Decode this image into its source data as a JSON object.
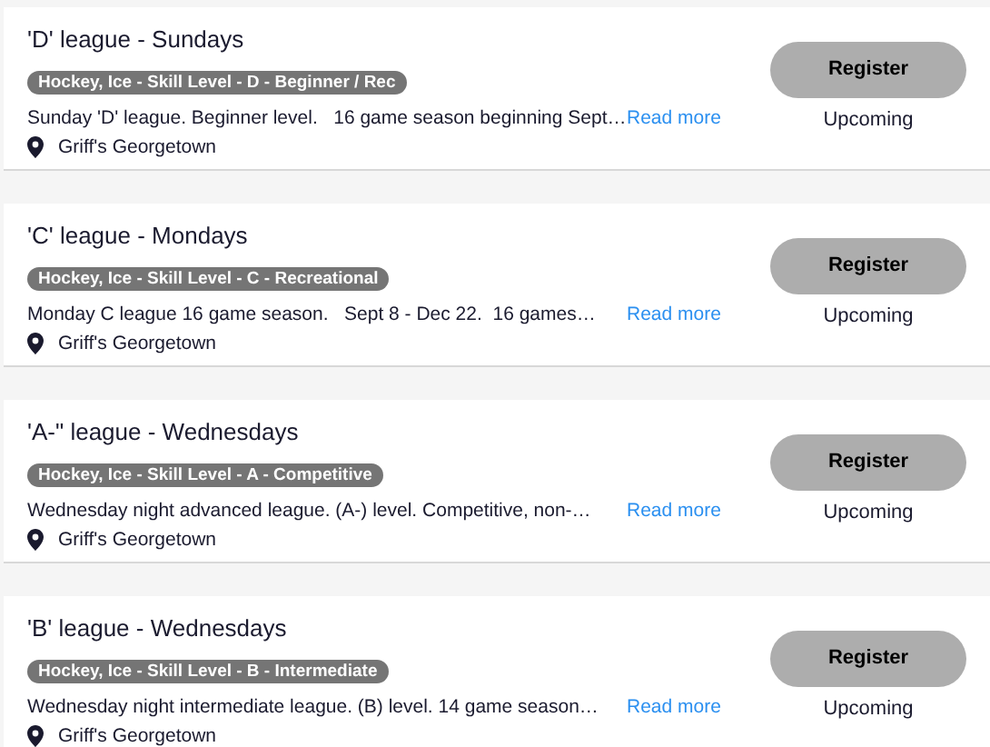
{
  "leagues": [
    {
      "title": "'D' league - Sundays",
      "tag": "Hockey, Ice - Skill Level - D - Beginner / Rec",
      "description": "Sunday 'D' league. Beginner level.   16 game season beginning Sept…",
      "link": "Read more",
      "location": "Griff's Georgetown",
      "button": "Register",
      "status": "Upcoming"
    },
    {
      "title": "'C' league - Mondays",
      "tag": "Hockey, Ice - Skill Level - C - Recreational",
      "description": "Monday C league 16 game season.   Sept 8 - Dec 22.  16 games…",
      "link": "Read more",
      "location": "Griff's Georgetown",
      "button": "Register",
      "status": "Upcoming"
    },
    {
      "title": "'A-\" league - Wednesdays",
      "tag": "Hockey, Ice - Skill Level - A - Competitive",
      "description": "Wednesday night advanced league. (A-) level. Competitive, non-…",
      "link": "Read more",
      "location": "Griff's Georgetown",
      "button": "Register",
      "status": "Upcoming"
    },
    {
      "title": "'B' league - Wednesdays",
      "tag": "Hockey, Ice - Skill Level - B - Intermediate",
      "description": "Wednesday night intermediate league. (B) level. 14 game season…",
      "link": "Read more",
      "location": "Griff's Georgetown",
      "button": "Register",
      "status": "Upcoming"
    }
  ]
}
